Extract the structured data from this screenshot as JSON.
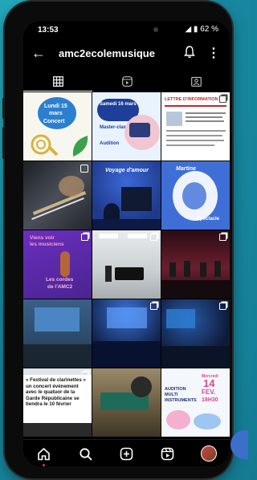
{
  "status_bar": {
    "time": "13:53",
    "battery": "62 %",
    "signal_icons": "◢ ▮"
  },
  "header": {
    "username": "amc2ecolemusique",
    "back_icon": "←",
    "more_icon": "⋮"
  },
  "tabs": [
    {
      "name": "grid",
      "active": true
    },
    {
      "name": "reels",
      "active": false
    },
    {
      "name": "tagged",
      "active": false
    }
  ],
  "posts": [
    {
      "lines": [
        "Lundi 15",
        "mars",
        "Concert"
      ],
      "bg": "#f7f7ef",
      "fg": "#2b7fd0"
    },
    {
      "lines": [
        "Samedi 16 mars",
        "Master-class",
        "Audition"
      ],
      "bg": "#e9f3ff",
      "fg": "#1d3f9a"
    },
    {
      "lines": [
        "LETTRE D'INFORMATION"
      ],
      "bg": "#ffffff",
      "fg": "#c0262d"
    },
    {
      "lines": [],
      "bg": "#2f3238",
      "fg": "#ffffff"
    },
    {
      "lines": [
        "Voyage d'amour"
      ],
      "bg": "#1f3a8a",
      "fg": "#ffffff"
    },
    {
      "lines": [
        "Martine",
        "Spectacle"
      ],
      "bg": "#3f6fd6",
      "fg": "#ffffff"
    },
    {
      "lines": [
        "Viens voir",
        "les musiciens",
        "Les cordes",
        "de l'AMC2"
      ],
      "bg": "#5a2ca8",
      "fg": "#ff9bd0"
    },
    {
      "lines": [],
      "bg": "#cdd3d6",
      "fg": "#ffffff"
    },
    {
      "lines": [],
      "bg": "#4a1824",
      "fg": "#ffffff"
    },
    {
      "lines": [],
      "bg": "#2c4a6a",
      "fg": "#ffffff"
    },
    {
      "lines": [],
      "bg": "#10214a",
      "fg": "#ffffff"
    },
    {
      "lines": [],
      "bg": "#0e1a38",
      "fg": "#ffffff"
    },
    {
      "lines": [
        "« Festival de clarinettes » un concert évènement avec le quatuor de la Garde Républicaine se tiendra le 10 février"
      ],
      "bg": "#ffffff",
      "fg": "#111111"
    },
    {
      "lines": [],
      "bg": "#7a6a4c",
      "fg": "#ffffff"
    },
    {
      "lines": [
        "Mercredi",
        "14",
        "FEV.",
        "18H30",
        "AUDITION",
        "MULTI",
        "INSTRUMENTS"
      ],
      "bg": "#f4f7fb",
      "fg": "#2a2f7a"
    }
  ],
  "bottom_nav": [
    "home",
    "search",
    "create",
    "reels",
    "profile"
  ]
}
